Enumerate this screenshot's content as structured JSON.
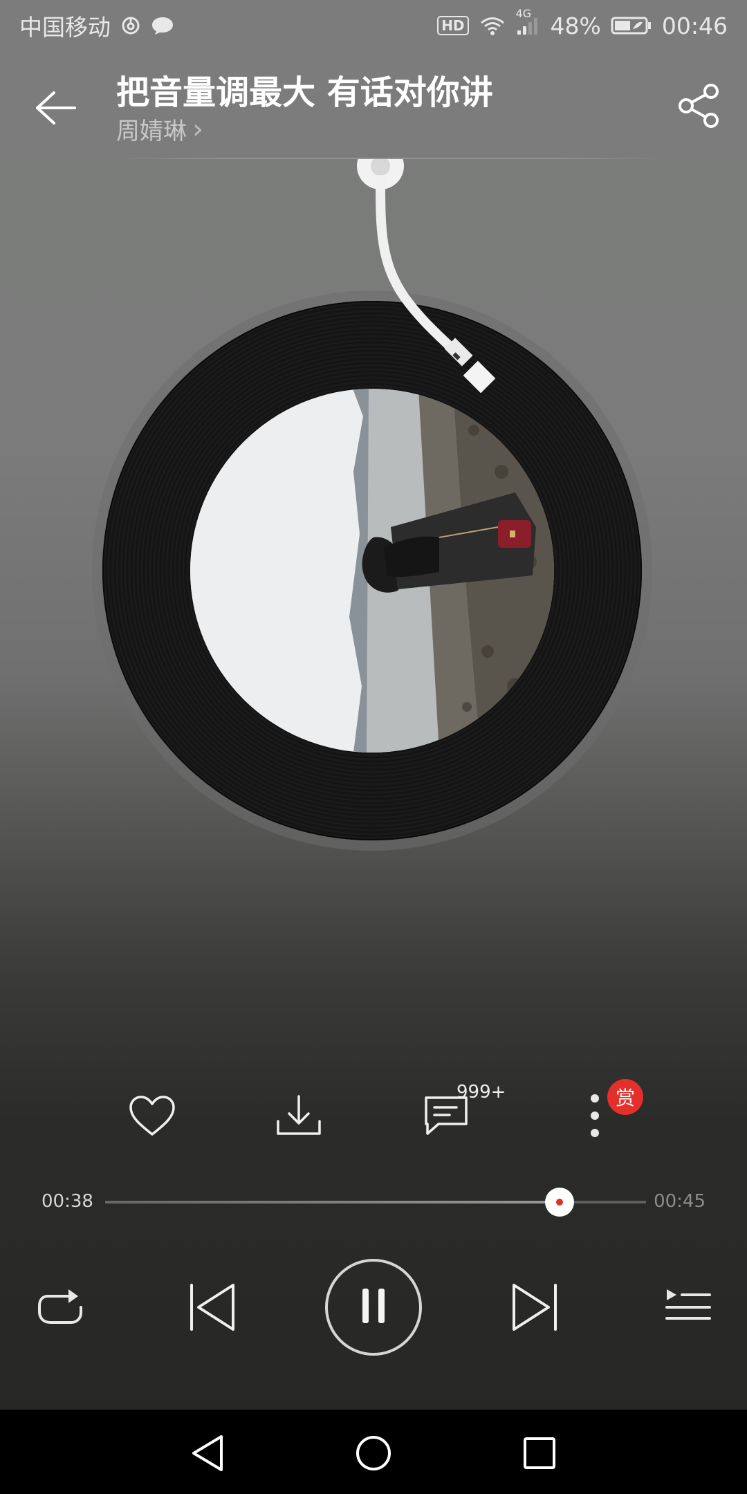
{
  "status_bar": {
    "carrier": "中国移动",
    "hd": "HD",
    "network": "4G",
    "battery": "48%",
    "time": "00:46"
  },
  "header": {
    "title": "把音量调最大 有话对你讲",
    "artist": "周婧琳",
    "artist_chevron": "›"
  },
  "actions": {
    "comment_count": "999+",
    "reward_badge": "赏"
  },
  "progress": {
    "current_time": "00:38",
    "total_time": "00:45",
    "fraction": 0.84
  },
  "icons": {
    "back": "back-arrow-icon",
    "share": "share-icon",
    "like": "heart-icon",
    "download": "download-icon",
    "comment": "comment-icon",
    "more": "more-vertical-icon",
    "repeat": "repeat-icon",
    "previous": "skip-previous-icon",
    "pause": "pause-icon",
    "next": "skip-next-icon",
    "playlist": "playlist-icon"
  },
  "colors": {
    "accent": "#e3302b"
  }
}
